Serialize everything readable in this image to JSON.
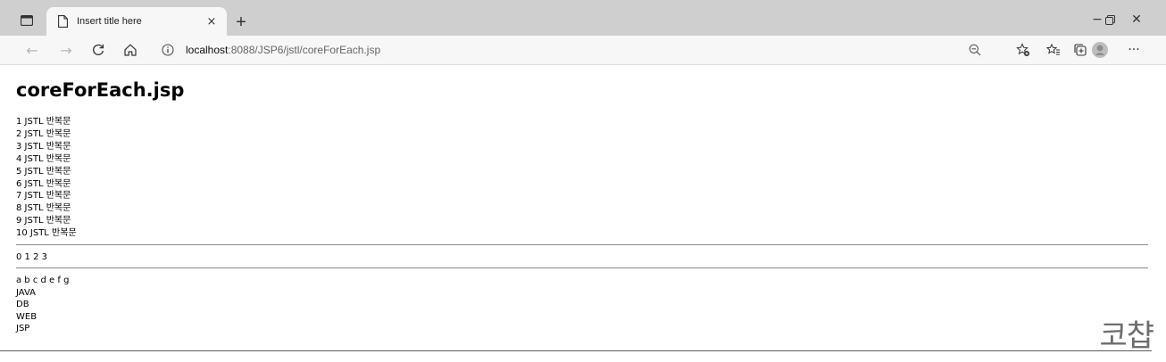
{
  "browser": {
    "tab_title": "Insert title here",
    "tab_close_glyph": "×",
    "new_tab_glyph": "+",
    "window": {
      "minimize": "−",
      "maximize": "▢",
      "close": "✕"
    },
    "nav": {
      "back": "←",
      "forward": "→",
      "reload": "↻",
      "home": "⌂"
    },
    "address": {
      "host": "localhost",
      "path": ":8088/JSP6/jstl/coreForEach.jsp"
    },
    "more_glyph": "···"
  },
  "page": {
    "title": "coreForEach.jsp",
    "loop_lines": [
      "1 JSTL 반복문",
      "2 JSTL 반복문",
      "3 JSTL 반복문",
      "4 JSTL 반복문",
      "5 JSTL 반복문",
      "6 JSTL 반복문",
      "7 JSTL 반복문",
      "8 JSTL 반복문",
      "9 JSTL 반복문",
      "10 JSTL 반복문"
    ],
    "numbers_line": "0 1 2 3",
    "letters_line": "a b c d e f g",
    "subjects": [
      "JAVA",
      "DB",
      "WEB",
      "JSP"
    ],
    "watermark": "코챱"
  },
  "colors": {
    "tabstrip": "#cfcfcf",
    "toolbar": "#f7f7f7",
    "rule": "#8a8a8a"
  }
}
